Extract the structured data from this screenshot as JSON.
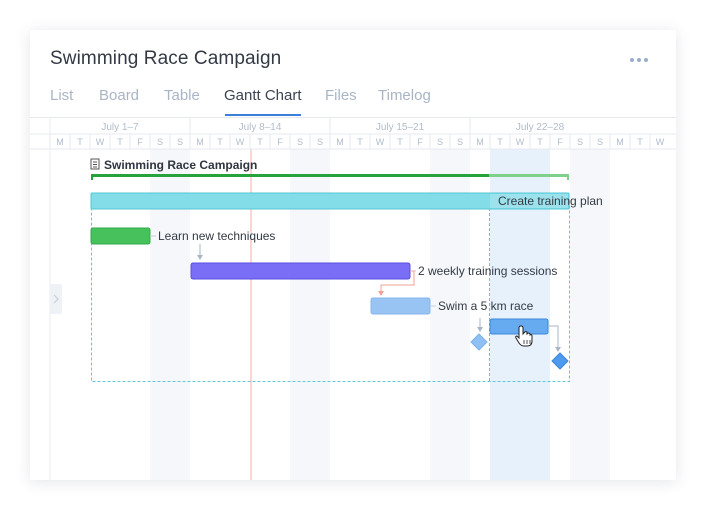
{
  "project": {
    "title": "Swimming Race Campaign"
  },
  "tabs": [
    {
      "label": "List",
      "active": false
    },
    {
      "label": "Board",
      "active": false
    },
    {
      "label": "Table",
      "active": false
    },
    {
      "label": "Gantt Chart",
      "active": true
    },
    {
      "label": "Files",
      "active": false
    },
    {
      "label": "Timelog",
      "active": false
    }
  ],
  "timeline": {
    "weeks": [
      "July 1–7",
      "July 8–14",
      "July 15–21",
      "July 22–28"
    ],
    "days": [
      "M",
      "T",
      "W",
      "T",
      "F",
      "S",
      "S",
      "M",
      "T",
      "W",
      "T",
      "F",
      "S",
      "S",
      "M",
      "T",
      "W",
      "T",
      "F",
      "S",
      "S",
      "M",
      "T",
      "W",
      "T",
      "F",
      "S",
      "S",
      "M",
      "T",
      "W"
    ],
    "today_marker_day": 10,
    "highlight_day": 22
  },
  "gantt": {
    "project_row": {
      "label": "Swimming Race Campaign",
      "icon": "document-icon"
    },
    "tasks": [
      {
        "label": "Create training plan",
        "color": "#83dde8",
        "border": "#56c6d6"
      },
      {
        "label": "Learn new techniques",
        "color": "#46c15c",
        "border": "#33a948"
      },
      {
        "label": "2 weekly training sessions",
        "color": "#7b6ef6",
        "border": "#5a4fe0"
      },
      {
        "label": "Swim a 5 km race",
        "color": "#98c4f3",
        "border": "#86b6ee"
      },
      {
        "label": "",
        "color": "#66aaf0",
        "border": "#3d86d8"
      }
    ],
    "milestones": [
      {
        "color": "#8ec0f3"
      },
      {
        "color": "#4d9aee"
      }
    ]
  },
  "colors": {
    "accent": "#3b7fd9",
    "weekend": "#f5f7fa",
    "today_line": "#f2aca6"
  }
}
